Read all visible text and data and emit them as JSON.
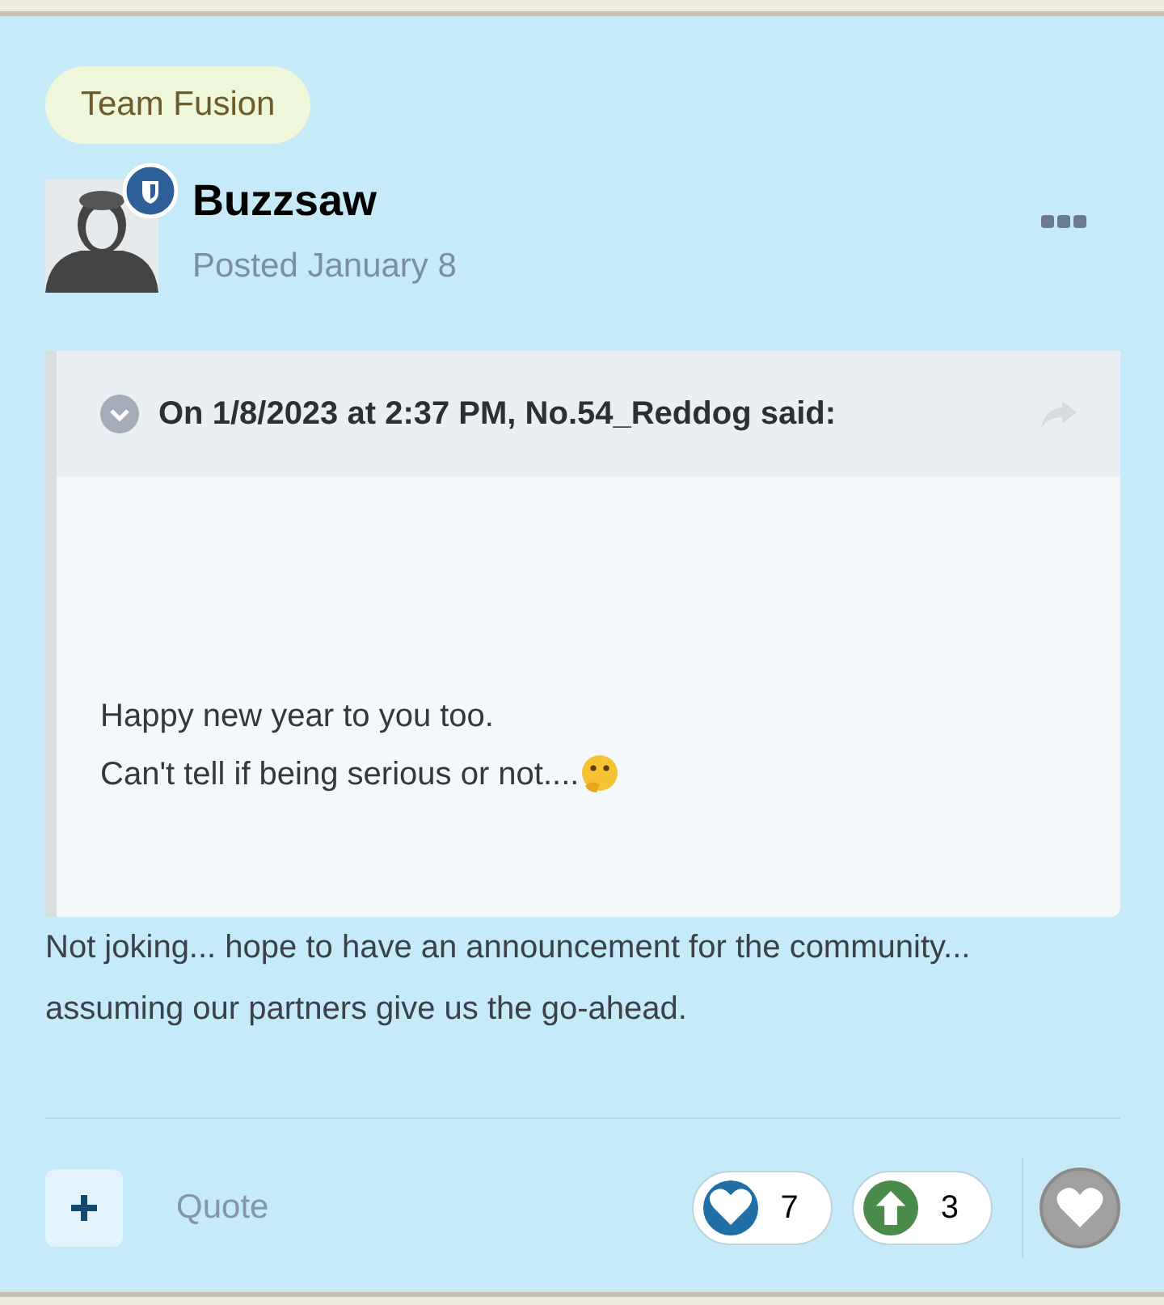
{
  "badge": "Team Fusion",
  "author": {
    "name": "Buzzsaw",
    "posted": "Posted January 8"
  },
  "quote": {
    "header": "On 1/8/2023 at 2:37 PM, No.54_Reddog said:",
    "lines": [
      "Happy new year to you too.",
      "Can't tell if being serious or not...."
    ]
  },
  "body": "Not joking... hope to have an announcement for the community... assuming our partners give us the go-ahead.",
  "footer": {
    "quote_label": "Quote",
    "reactions": [
      {
        "kind": "heart",
        "count": "7",
        "color": "#1f6fa6"
      },
      {
        "kind": "upvote",
        "count": "3",
        "color": "#4a8a4a"
      }
    ]
  }
}
